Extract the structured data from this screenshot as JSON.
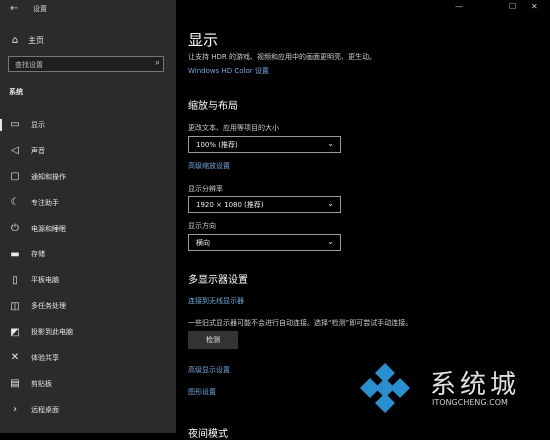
{
  "window": {
    "back_icon": "back-arrow-icon",
    "title": "设置",
    "controls": [
      "—",
      "☐",
      "✕"
    ]
  },
  "sidebar": {
    "home_label": "主页",
    "search_placeholder": "查找设置",
    "section_title": "系统",
    "items": [
      {
        "label": "显示",
        "icon": "monitor-icon",
        "active": true
      },
      {
        "label": "声音",
        "icon": "speaker-icon"
      },
      {
        "label": "通知和操作",
        "icon": "notification-icon"
      },
      {
        "label": "专注助手",
        "icon": "moon-icon"
      },
      {
        "label": "电源和睡眠",
        "icon": "power-icon"
      },
      {
        "label": "存储",
        "icon": "storage-icon"
      },
      {
        "label": "平板电脑",
        "icon": "tablet-icon"
      },
      {
        "label": "多任务处理",
        "icon": "multitask-icon"
      },
      {
        "label": "投影到此电脑",
        "icon": "project-icon"
      },
      {
        "label": "体验共享",
        "icon": "share-icon"
      },
      {
        "label": "剪贴板",
        "icon": "clipboard-icon"
      },
      {
        "label": "远程桌面",
        "icon": "remote-icon"
      }
    ]
  },
  "main": {
    "title": "显示",
    "hdr_desc": "让支持 HDR 的游戏、视频和应用中的画面更明亮、更生动。",
    "hdr_link": "Windows HD Color 设置",
    "scale_heading": "缩放与布局",
    "scale_label": "更改文本、应用等项目的大小",
    "scale_value": "100% (推荐)",
    "adv_scale_link": "高级缩放设置",
    "res_label": "显示分辨率",
    "res_value": "1920 × 1080 (推荐)",
    "orient_label": "显示方向",
    "orient_value": "横向",
    "multi_heading": "多显示器设置",
    "wireless_link": "连接到无线显示器",
    "detect_desc": "一些旧式显示器可能不会进行自动连接。选择“检测”即可尝试手动连接。",
    "detect_button": "检测",
    "adv_display_link": "高级显示设置",
    "graphics_link": "图形设置",
    "next_heading": "夜间模式"
  },
  "watermark": {
    "text": "系统城",
    "url": "ITONGCHENG.COM"
  }
}
